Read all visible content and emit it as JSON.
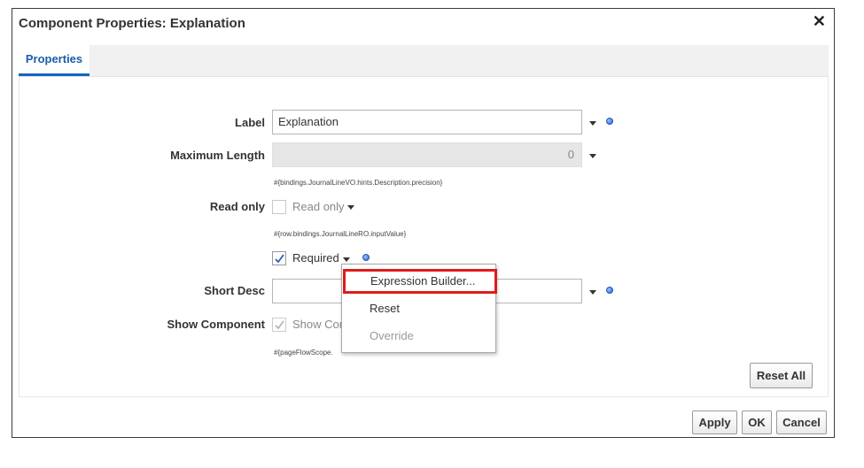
{
  "dialog": {
    "title": "Component Properties: Explanation",
    "close_glyph": "✕"
  },
  "tabs": [
    {
      "label": "Properties"
    }
  ],
  "form": {
    "label": {
      "label": "Label",
      "value": "Explanation"
    },
    "max_length": {
      "label": "Maximum Length",
      "value": "0",
      "expression": "#{bindings.JournalLineVO.hints.Description.precision}"
    },
    "read_only": {
      "label": "Read only",
      "checkbox_text": "Read only",
      "checked": false,
      "expression": "#{row.bindings.JournalLineRO.inputValue}"
    },
    "required": {
      "checkbox_text": "Required",
      "checked": true
    },
    "short_desc": {
      "label": "Short Desc",
      "value": ""
    },
    "show_component": {
      "label": "Show Component",
      "checkbox_text": "Show Com",
      "checked": true,
      "expression": "#{pageFlowScope."
    }
  },
  "context_menu": {
    "items": [
      "Expression Builder...",
      "Reset",
      "Override"
    ],
    "highlighted": "Expression Builder...",
    "disabled": [
      "Override"
    ]
  },
  "buttons": {
    "reset_all": "Reset All",
    "apply": "Apply",
    "ok": "OK",
    "cancel": "Cancel"
  },
  "colors": {
    "tab_accent": "#1565c0",
    "highlight_border": "#e01b1b",
    "indicator_dot": "#1f5fd6"
  }
}
